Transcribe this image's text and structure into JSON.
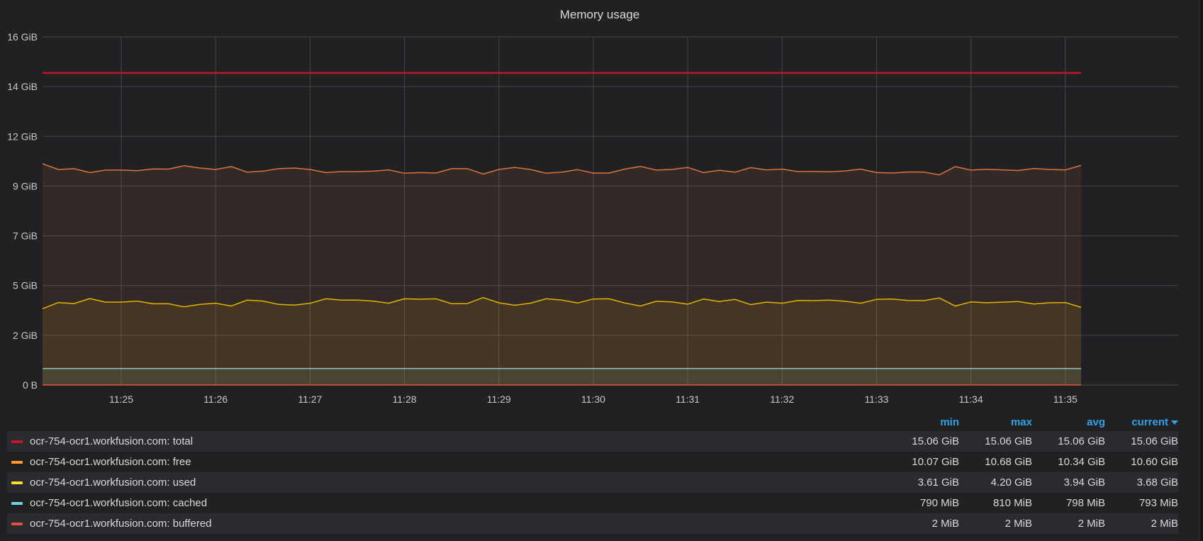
{
  "chart_data": {
    "type": "area",
    "title": "Memory usage",
    "y_ticks": [
      "16 GiB",
      "14 GiB",
      "12 GiB",
      "9 GiB",
      "7 GiB",
      "5 GiB",
      "2 GiB",
      "0 B"
    ],
    "ylim": [
      0,
      16.8
    ],
    "x_ticks": [
      "11:25",
      "11:26",
      "11:27",
      "11:28",
      "11:29",
      "11:30",
      "11:31",
      "11:32",
      "11:33",
      "11:34",
      "11:35"
    ],
    "x_range": [
      "11:24:10",
      "11:35:10"
    ],
    "grid": true,
    "legend_placement": "bottom",
    "series": [
      {
        "name": "ocr-754-ocr1.workfusion.com: total",
        "color": "#e02f44",
        "line_color": "#c4162a",
        "fill": false,
        "x": [
          "11:24:10",
          "11:35:10"
        ],
        "values": [
          15.06,
          15.06
        ],
        "stats": {
          "min": "15.06 GiB",
          "max": "15.06 GiB",
          "avg": "15.06 GiB",
          "current": "15.06 GiB"
        }
      },
      {
        "name": "ocr-754-ocr1.workfusion.com: free",
        "color": "#ff9830",
        "line_color": "#d9743b",
        "fill": true,
        "values": [
          10.68,
          10.4,
          10.44,
          10.25,
          10.37,
          10.37,
          10.34,
          10.43,
          10.42,
          10.58,
          10.47,
          10.4,
          10.54,
          10.27,
          10.32,
          10.44,
          10.47,
          10.4,
          10.25,
          10.3,
          10.3,
          10.32,
          10.38,
          10.22,
          10.25,
          10.23,
          10.44,
          10.44,
          10.18,
          10.4,
          10.5,
          10.4,
          10.22,
          10.27,
          10.39,
          10.23,
          10.23,
          10.42,
          10.55,
          10.37,
          10.4,
          10.5,
          10.25,
          10.36,
          10.27,
          10.49,
          10.38,
          10.42,
          10.3,
          10.31,
          10.29,
          10.33,
          10.42,
          10.25,
          10.23,
          10.28,
          10.28,
          10.14,
          10.54,
          10.37,
          10.41,
          10.38,
          10.35,
          10.45,
          10.4,
          10.38,
          10.6
        ]
      },
      {
        "name": "ocr-754-ocr1.workfusion.com: used",
        "color": "#fade2a",
        "line_color": "#e0b400",
        "fill": true,
        "values": [
          3.68,
          3.98,
          3.93,
          4.17,
          4.0,
          4.0,
          4.05,
          3.92,
          3.92,
          3.77,
          3.89,
          3.95,
          3.81,
          4.1,
          4.05,
          3.89,
          3.86,
          3.94,
          4.16,
          4.1,
          4.1,
          4.05,
          3.95,
          4.16,
          4.14,
          4.16,
          3.92,
          3.93,
          4.22,
          3.97,
          3.85,
          3.95,
          4.16,
          4.1,
          3.96,
          4.15,
          4.16,
          3.96,
          3.81,
          4.04,
          4.01,
          3.9,
          4.15,
          4.03,
          4.13,
          3.88,
          4.0,
          3.95,
          4.08,
          4.07,
          4.1,
          4.04,
          3.95,
          4.13,
          4.15,
          4.08,
          4.07,
          4.2,
          3.81,
          4.01,
          3.97,
          4.0,
          4.03,
          3.91,
          3.97,
          3.98,
          3.75
        ]
      },
      {
        "name": "ocr-754-ocr1.workfusion.com: cached",
        "color": "#8ab8ff",
        "line_color": "#86c3c9",
        "fill": true,
        "x": [
          "11:24:10",
          "11:35:10"
        ],
        "values": [
          0.793,
          0.793
        ],
        "stats": {
          "min": "790 MiB",
          "max": "810 MiB",
          "avg": "798 MiB",
          "current": "793 MiB"
        }
      },
      {
        "name": "ocr-754-ocr1.workfusion.com: buffered",
        "color": "#f2495c",
        "line_color": "#e55545",
        "fill": true,
        "x": [
          "11:24:10",
          "11:35:10"
        ],
        "values": [
          0.002,
          0.002
        ],
        "stats": {
          "min": "2 MiB",
          "max": "2 MiB",
          "avg": "2 MiB",
          "current": "2 MiB"
        }
      }
    ]
  },
  "legend": {
    "columns": [
      "min",
      "max",
      "avg",
      "current"
    ],
    "sorted_by": "current",
    "rows": [
      {
        "name": "ocr-754-ocr1.workfusion.com: total",
        "color": "#c4162a",
        "min": "15.06 GiB",
        "max": "15.06 GiB",
        "avg": "15.06 GiB",
        "current": "15.06 GiB"
      },
      {
        "name": "ocr-754-ocr1.workfusion.com: free",
        "color": "#ff9830",
        "min": "10.07 GiB",
        "max": "10.68 GiB",
        "avg": "10.34 GiB",
        "current": "10.60 GiB"
      },
      {
        "name": "ocr-754-ocr1.workfusion.com: used",
        "color": "#fade2a",
        "min": "3.61 GiB",
        "max": "4.20 GiB",
        "avg": "3.94 GiB",
        "current": "3.68 GiB"
      },
      {
        "name": "ocr-754-ocr1.workfusion.com: cached",
        "color": "#73d1e6",
        "min": "790 MiB",
        "max": "810 MiB",
        "avg": "798 MiB",
        "current": "793 MiB"
      },
      {
        "name": "ocr-754-ocr1.workfusion.com: buffered",
        "color": "#e05040",
        "min": "2 MiB",
        "max": "2 MiB",
        "avg": "2 MiB",
        "current": "2 MiB"
      }
    ]
  }
}
